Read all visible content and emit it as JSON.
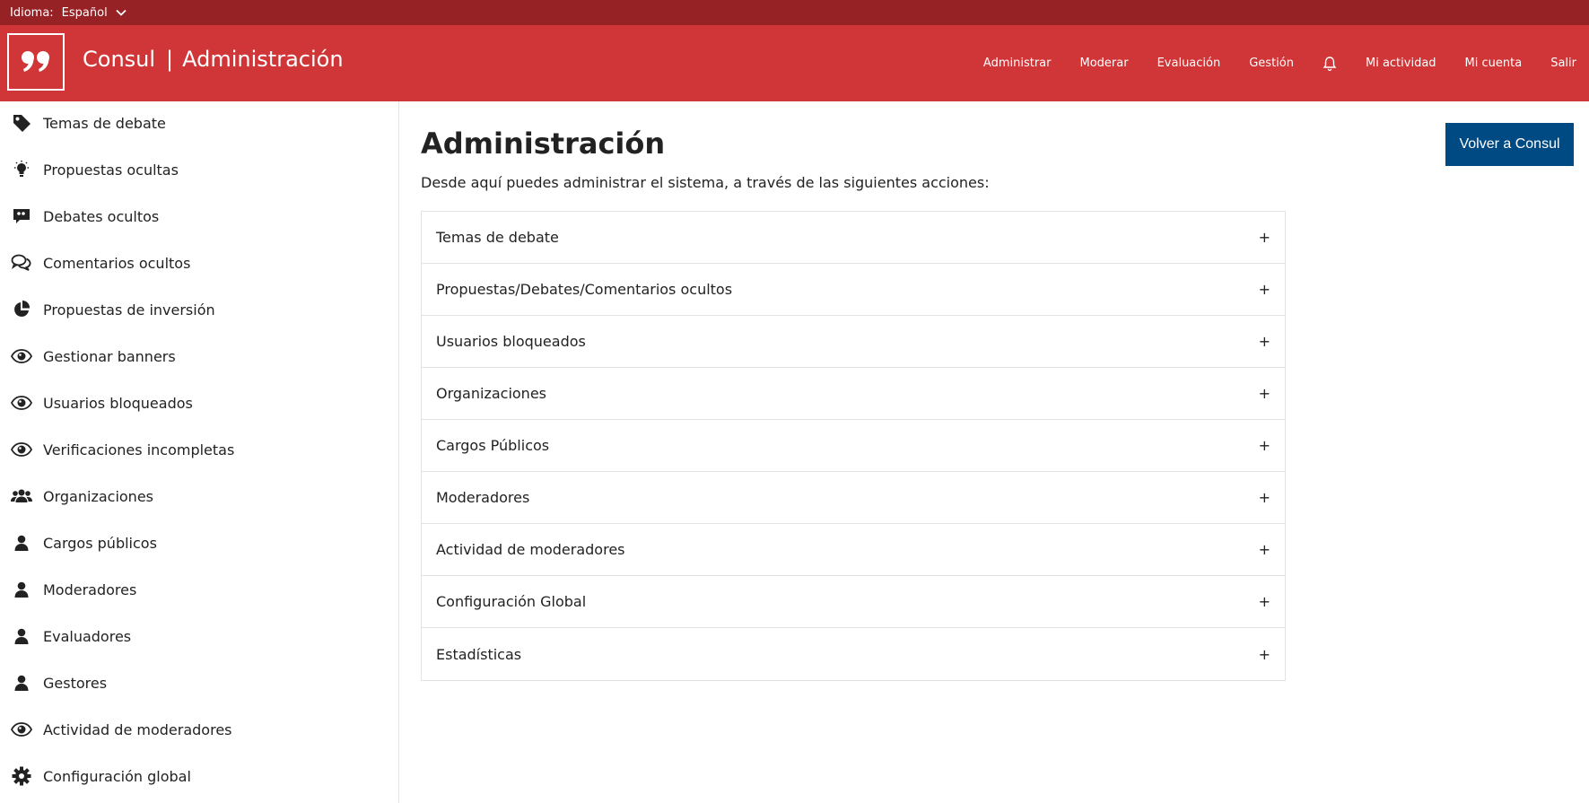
{
  "topbar": {
    "language_label": "Idioma:",
    "language_value": "Español"
  },
  "header": {
    "brand": "Consul",
    "section": "Administración",
    "nav": [
      "Administrar",
      "Moderar",
      "Evaluación",
      "Gestión",
      "Mi actividad",
      "Mi cuenta",
      "Salir"
    ]
  },
  "sidebar": {
    "items": [
      {
        "label": "Temas de debate",
        "icon": "tag-icon"
      },
      {
        "label": "Propuestas ocultas",
        "icon": "lightbulb-icon"
      },
      {
        "label": "Debates ocultos",
        "icon": "quote-bubble-icon"
      },
      {
        "label": "Comentarios ocultos",
        "icon": "comments-icon"
      },
      {
        "label": "Propuestas de inversión",
        "icon": "pie-chart-icon"
      },
      {
        "label": "Gestionar banners",
        "icon": "eye-icon"
      },
      {
        "label": "Usuarios bloqueados",
        "icon": "eye-icon"
      },
      {
        "label": "Verificaciones incompletas",
        "icon": "eye-icon"
      },
      {
        "label": "Organizaciones",
        "icon": "group-icon"
      },
      {
        "label": "Cargos públicos",
        "icon": "user-icon"
      },
      {
        "label": "Moderadores",
        "icon": "user-icon"
      },
      {
        "label": "Evaluadores",
        "icon": "user-icon"
      },
      {
        "label": "Gestores",
        "icon": "user-icon"
      },
      {
        "label": "Actividad de moderadores",
        "icon": "eye-icon"
      },
      {
        "label": "Configuración global",
        "icon": "gear-icon"
      }
    ]
  },
  "main": {
    "title": "Administración",
    "description": "Desde aquí puedes administrar el sistema, a través de las siguientes acciones:",
    "back_button": "Volver a Consul",
    "accordion": [
      "Temas de debate",
      "Propuestas/Debates/Comentarios ocultos",
      "Usuarios bloqueados",
      "Organizaciones",
      "Cargos Públicos",
      "Moderadores",
      "Actividad de moderadores",
      "Configuración Global",
      "Estadísticas"
    ],
    "expand_symbol": "+"
  },
  "colors": {
    "topbar": "#962225",
    "header": "#d03537",
    "button": "#004a83"
  }
}
